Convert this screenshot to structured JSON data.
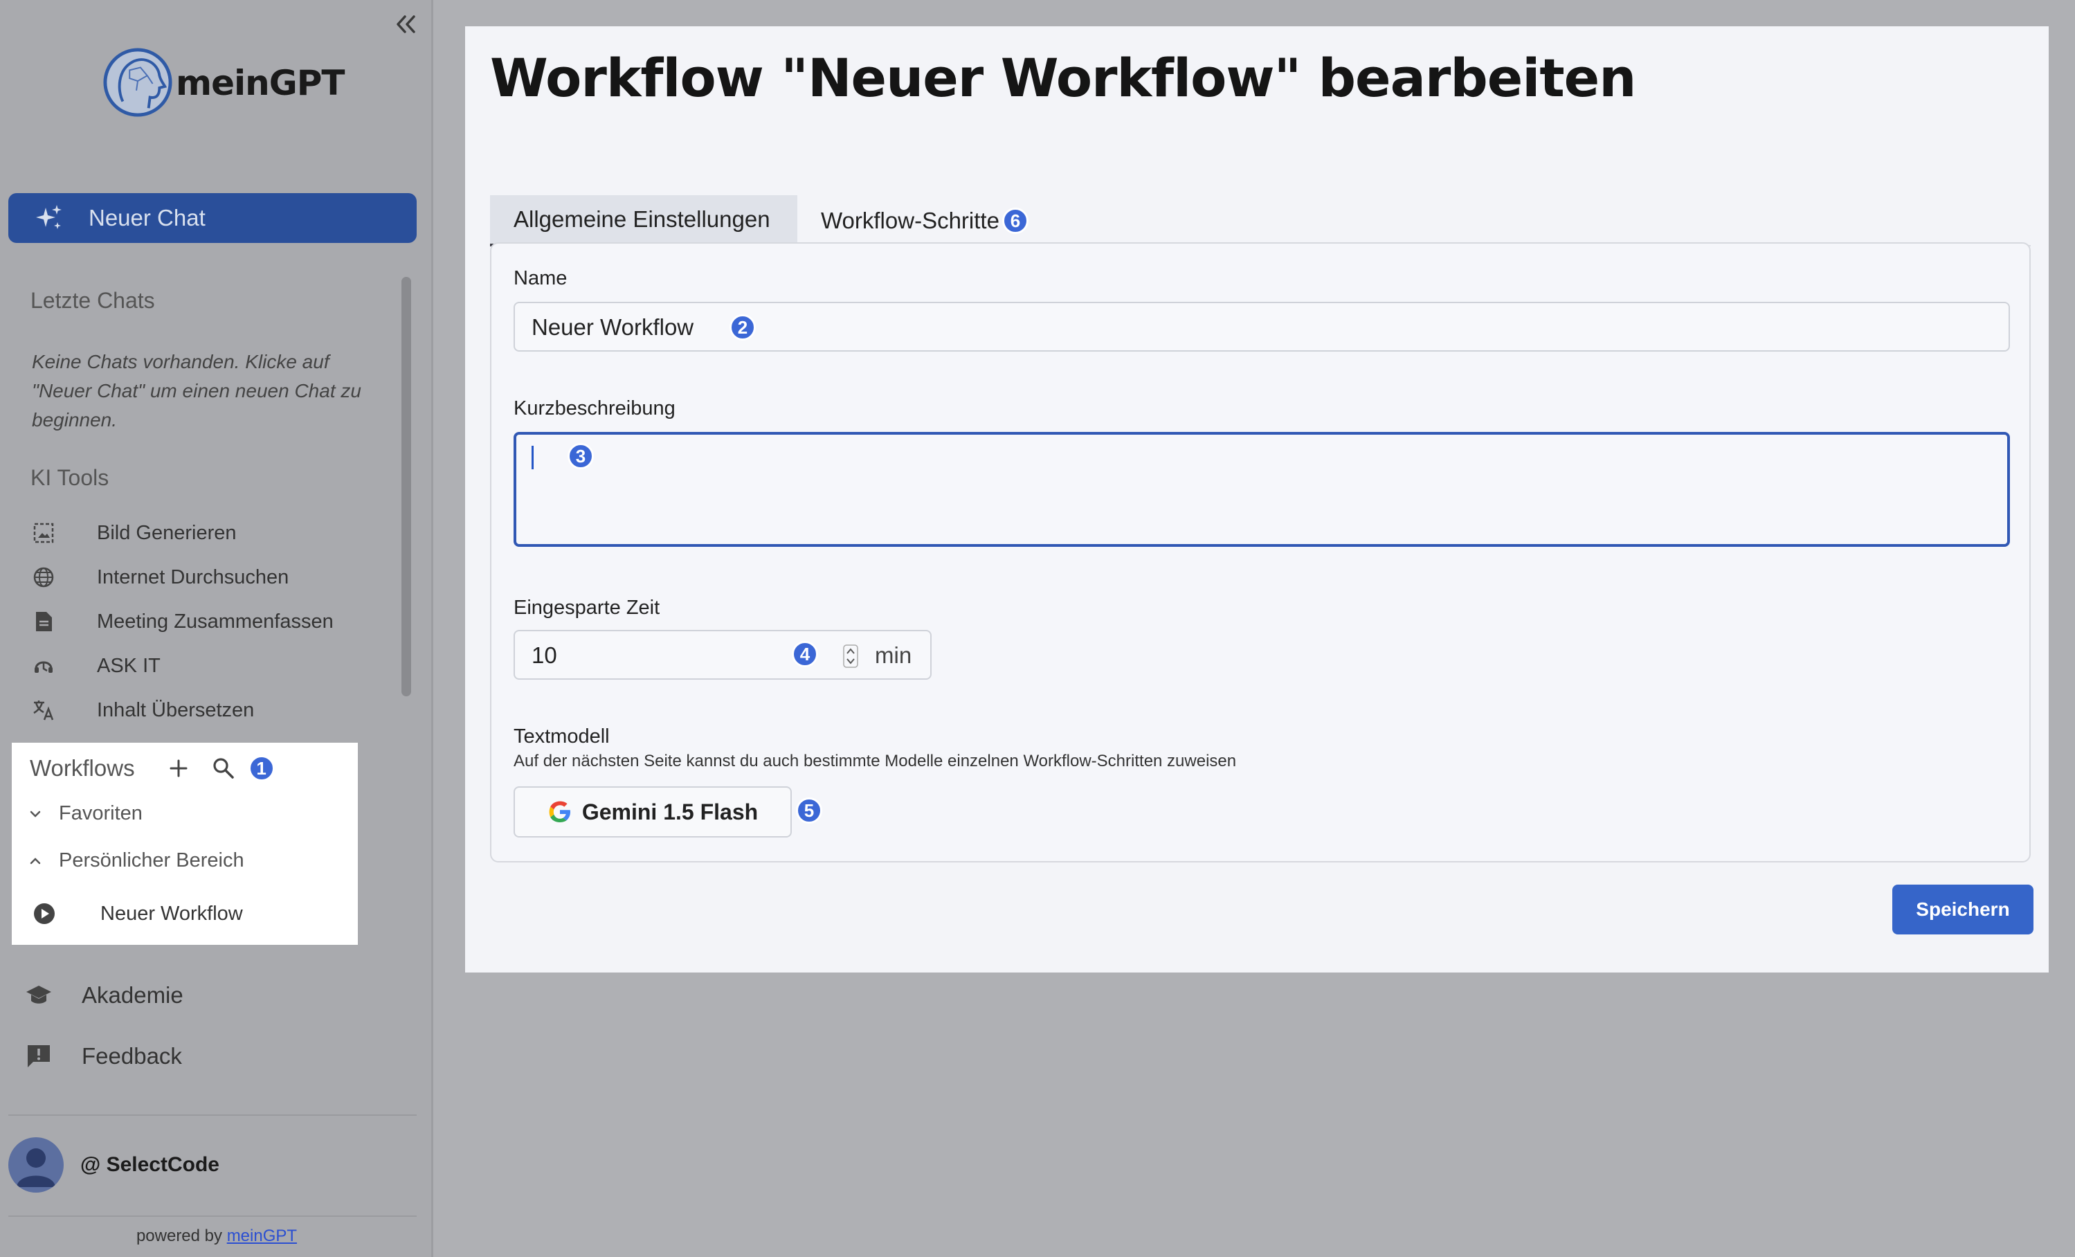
{
  "sidebar": {
    "brand": "meinGPT",
    "new_chat": "Neuer Chat",
    "recent_title": "Letzte Chats",
    "recent_empty": "Keine Chats vorhanden. Klicke auf \"Neuer Chat\" um einen neuen Chat zu beginnen.",
    "tools_title": "KI Tools",
    "tools": [
      {
        "label": "Bild Generieren",
        "icon": "image-icon"
      },
      {
        "label": "Internet Durchsuchen",
        "icon": "globe-icon"
      },
      {
        "label": "Meeting Zusammenfassen",
        "icon": "document-icon"
      },
      {
        "label": "ASK IT",
        "icon": "support-icon"
      },
      {
        "label": "Inhalt Übersetzen",
        "icon": "translate-icon"
      }
    ],
    "workflows": {
      "title": "Workflows",
      "badge": "1",
      "groups": [
        {
          "label": "Favoriten",
          "expanded": false
        },
        {
          "label": "Persönlicher Bereich",
          "expanded": true
        }
      ],
      "items": [
        {
          "label": "Neuer Workflow",
          "icon": "play-circle-icon"
        }
      ]
    },
    "bottom": [
      {
        "label": "Akademie",
        "icon": "graduation-cap-icon"
      },
      {
        "label": "Feedback",
        "icon": "feedback-icon"
      }
    ],
    "user": "@ SelectCode",
    "powered_prefix": "powered by ",
    "powered_link": "meinGPT"
  },
  "main": {
    "title": "Workflow \"Neuer Workflow\" bearbeiten",
    "tabs": [
      {
        "label": "Allgemeine Einstellungen",
        "active": true
      },
      {
        "label": "Workflow-Schritte",
        "badge": "6"
      }
    ],
    "form": {
      "name_label": "Name",
      "name_value": "Neuer Workflow",
      "name_badge": "2",
      "desc_label": "Kurzbeschreibung",
      "desc_value": "",
      "desc_badge": "3",
      "time_label": "Eingesparte Zeit",
      "time_value": "10",
      "time_badge": "4",
      "time_unit": "min",
      "model_label": "Textmodell",
      "model_hint": "Auf der nächsten Seite kannst du auch bestimmte Modelle einzelnen Workflow-Schritten zuweisen",
      "model_value": "Gemini 1.5 Flash",
      "model_badge": "5"
    },
    "save": "Speichern"
  },
  "colors": {
    "accent": "#3665c9",
    "new_chat_bg": "#2a4f9a",
    "badge": "#3b67d6",
    "focus_border": "#3158b4"
  }
}
